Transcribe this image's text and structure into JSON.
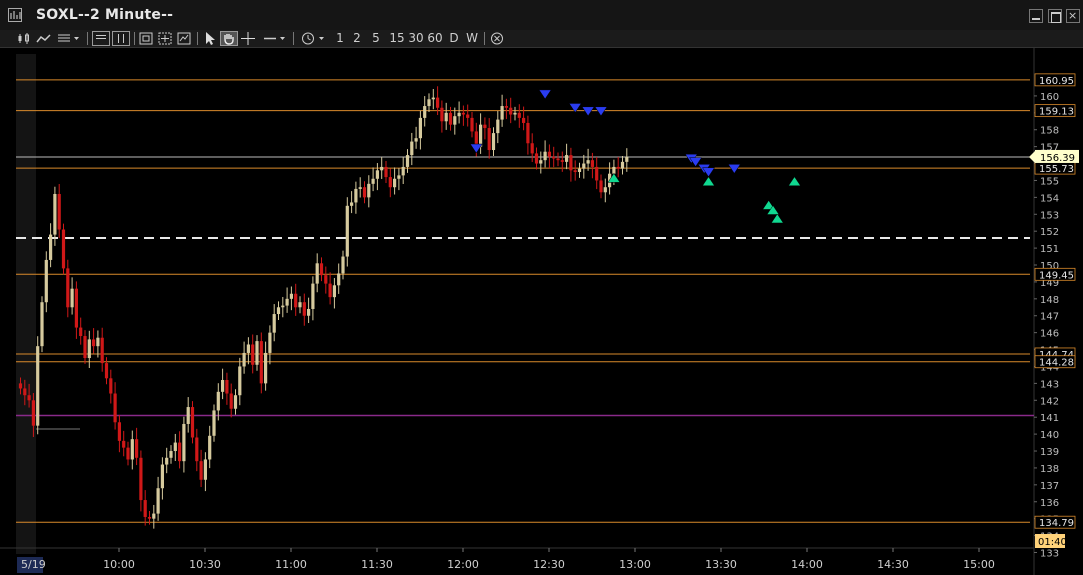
{
  "window": {
    "title": "SOXL--2 Minute--"
  },
  "toolbar": {
    "intervals": [
      "1",
      "2",
      "5",
      "15",
      "30",
      "60",
      "D",
      "W"
    ]
  },
  "axis": {
    "price_ticks": [
      "160",
      "159",
      "158",
      "157",
      "156",
      "155",
      "154",
      "153",
      "152",
      "151",
      "150",
      "149",
      "148",
      "147",
      "146",
      "145",
      "144",
      "143",
      "142",
      "141",
      "140",
      "139",
      "138",
      "137",
      "136",
      "135",
      "134",
      "133"
    ],
    "time_labels": [
      "10:00",
      "10:30",
      "11:00",
      "11:30",
      "12:00",
      "12:30",
      "13:00",
      "13:30",
      "14:00",
      "14:30",
      "15:00"
    ],
    "date_label": "5/19",
    "countdown": "01:40"
  },
  "levels": [
    {
      "label": "160.95",
      "color": "#d98a2b",
      "price": 160.95
    },
    {
      "label": "159.13",
      "color": "#d98a2b",
      "price": 159.13
    },
    {
      "label": "155.73",
      "color": "#d98a2b",
      "price": 155.73
    },
    {
      "label": "149.45",
      "color": "#d98a2b",
      "price": 149.45
    },
    {
      "label": "144.74",
      "color": "#d98a2b",
      "price": 144.74
    },
    {
      "label": "144.28",
      "color": "#d98a2b",
      "price": 144.28
    },
    {
      "label": "134.79",
      "color": "#d98a2b",
      "price": 134.79
    }
  ],
  "last_price": {
    "label": "156.39",
    "price": 156.39
  },
  "dashed_level": {
    "price": 151.6
  },
  "purple_level": {
    "price": 141.1,
    "color": "#8a2a8a"
  },
  "chart_data": {
    "type": "candlestick",
    "symbol": "SOXL",
    "interval": "2 Minute",
    "colors": {
      "up": "#d6ca9e",
      "down": "#d01818",
      "sell_arrow": "#2a3cf0",
      "buy_arrow": "#10d890"
    },
    "closes": [
      142.7,
      142.3,
      142.0,
      140.5,
      145.2,
      147.8,
      150.3,
      151.8,
      154.2,
      152.1,
      149.8,
      147.5,
      148.6,
      146.3,
      145.8,
      144.5,
      145.6,
      145.2,
      145.7,
      144.2,
      143.3,
      142.4,
      140.7,
      139.6,
      139.2,
      138.5,
      139.7,
      138.6,
      136.1,
      135.1,
      135.0,
      135.3,
      136.8,
      138.2,
      138.6,
      139.0,
      139.5,
      138.4,
      140.6,
      141.6,
      139.8,
      138.4,
      137.3,
      138.5,
      139.9,
      141.4,
      142.5,
      143.2,
      142.4,
      141.5,
      142.3,
      144.0,
      144.8,
      145.3,
      144.1,
      145.5,
      143.0,
      144.8,
      146.0,
      147.1,
      147.5,
      147.6,
      148.0,
      148.3,
      147.5,
      147.8,
      147.0,
      147.4,
      148.9,
      150.1,
      149.4,
      148.9,
      148.1,
      148.8,
      149.5,
      150.5,
      153.5,
      153.7,
      154.5,
      154.6,
      154.0,
      154.8,
      155.1,
      155.6,
      155.8,
      155.2,
      154.6,
      155.1,
      155.3,
      155.8,
      156.5,
      157.3,
      157.5,
      158.7,
      159.4,
      159.8,
      159.9,
      159.3,
      158.5,
      159.0,
      158.3,
      158.8,
      159.0,
      158.9,
      158.7,
      157.9,
      157.0,
      158.3,
      158.1,
      156.8,
      157.8,
      158.6,
      159.4,
      159.3,
      158.9,
      159.0,
      158.7,
      158.4,
      157.2,
      156.6,
      156.0,
      156.2,
      156.7,
      156.4,
      156.3,
      156.2,
      156.1,
      156.5,
      155.6,
      155.5,
      155.7,
      156.0,
      156.2,
      155.8,
      155.0,
      154.3,
      154.6,
      155.4,
      155.8,
      155.7,
      156.1,
      156.4
    ]
  }
}
